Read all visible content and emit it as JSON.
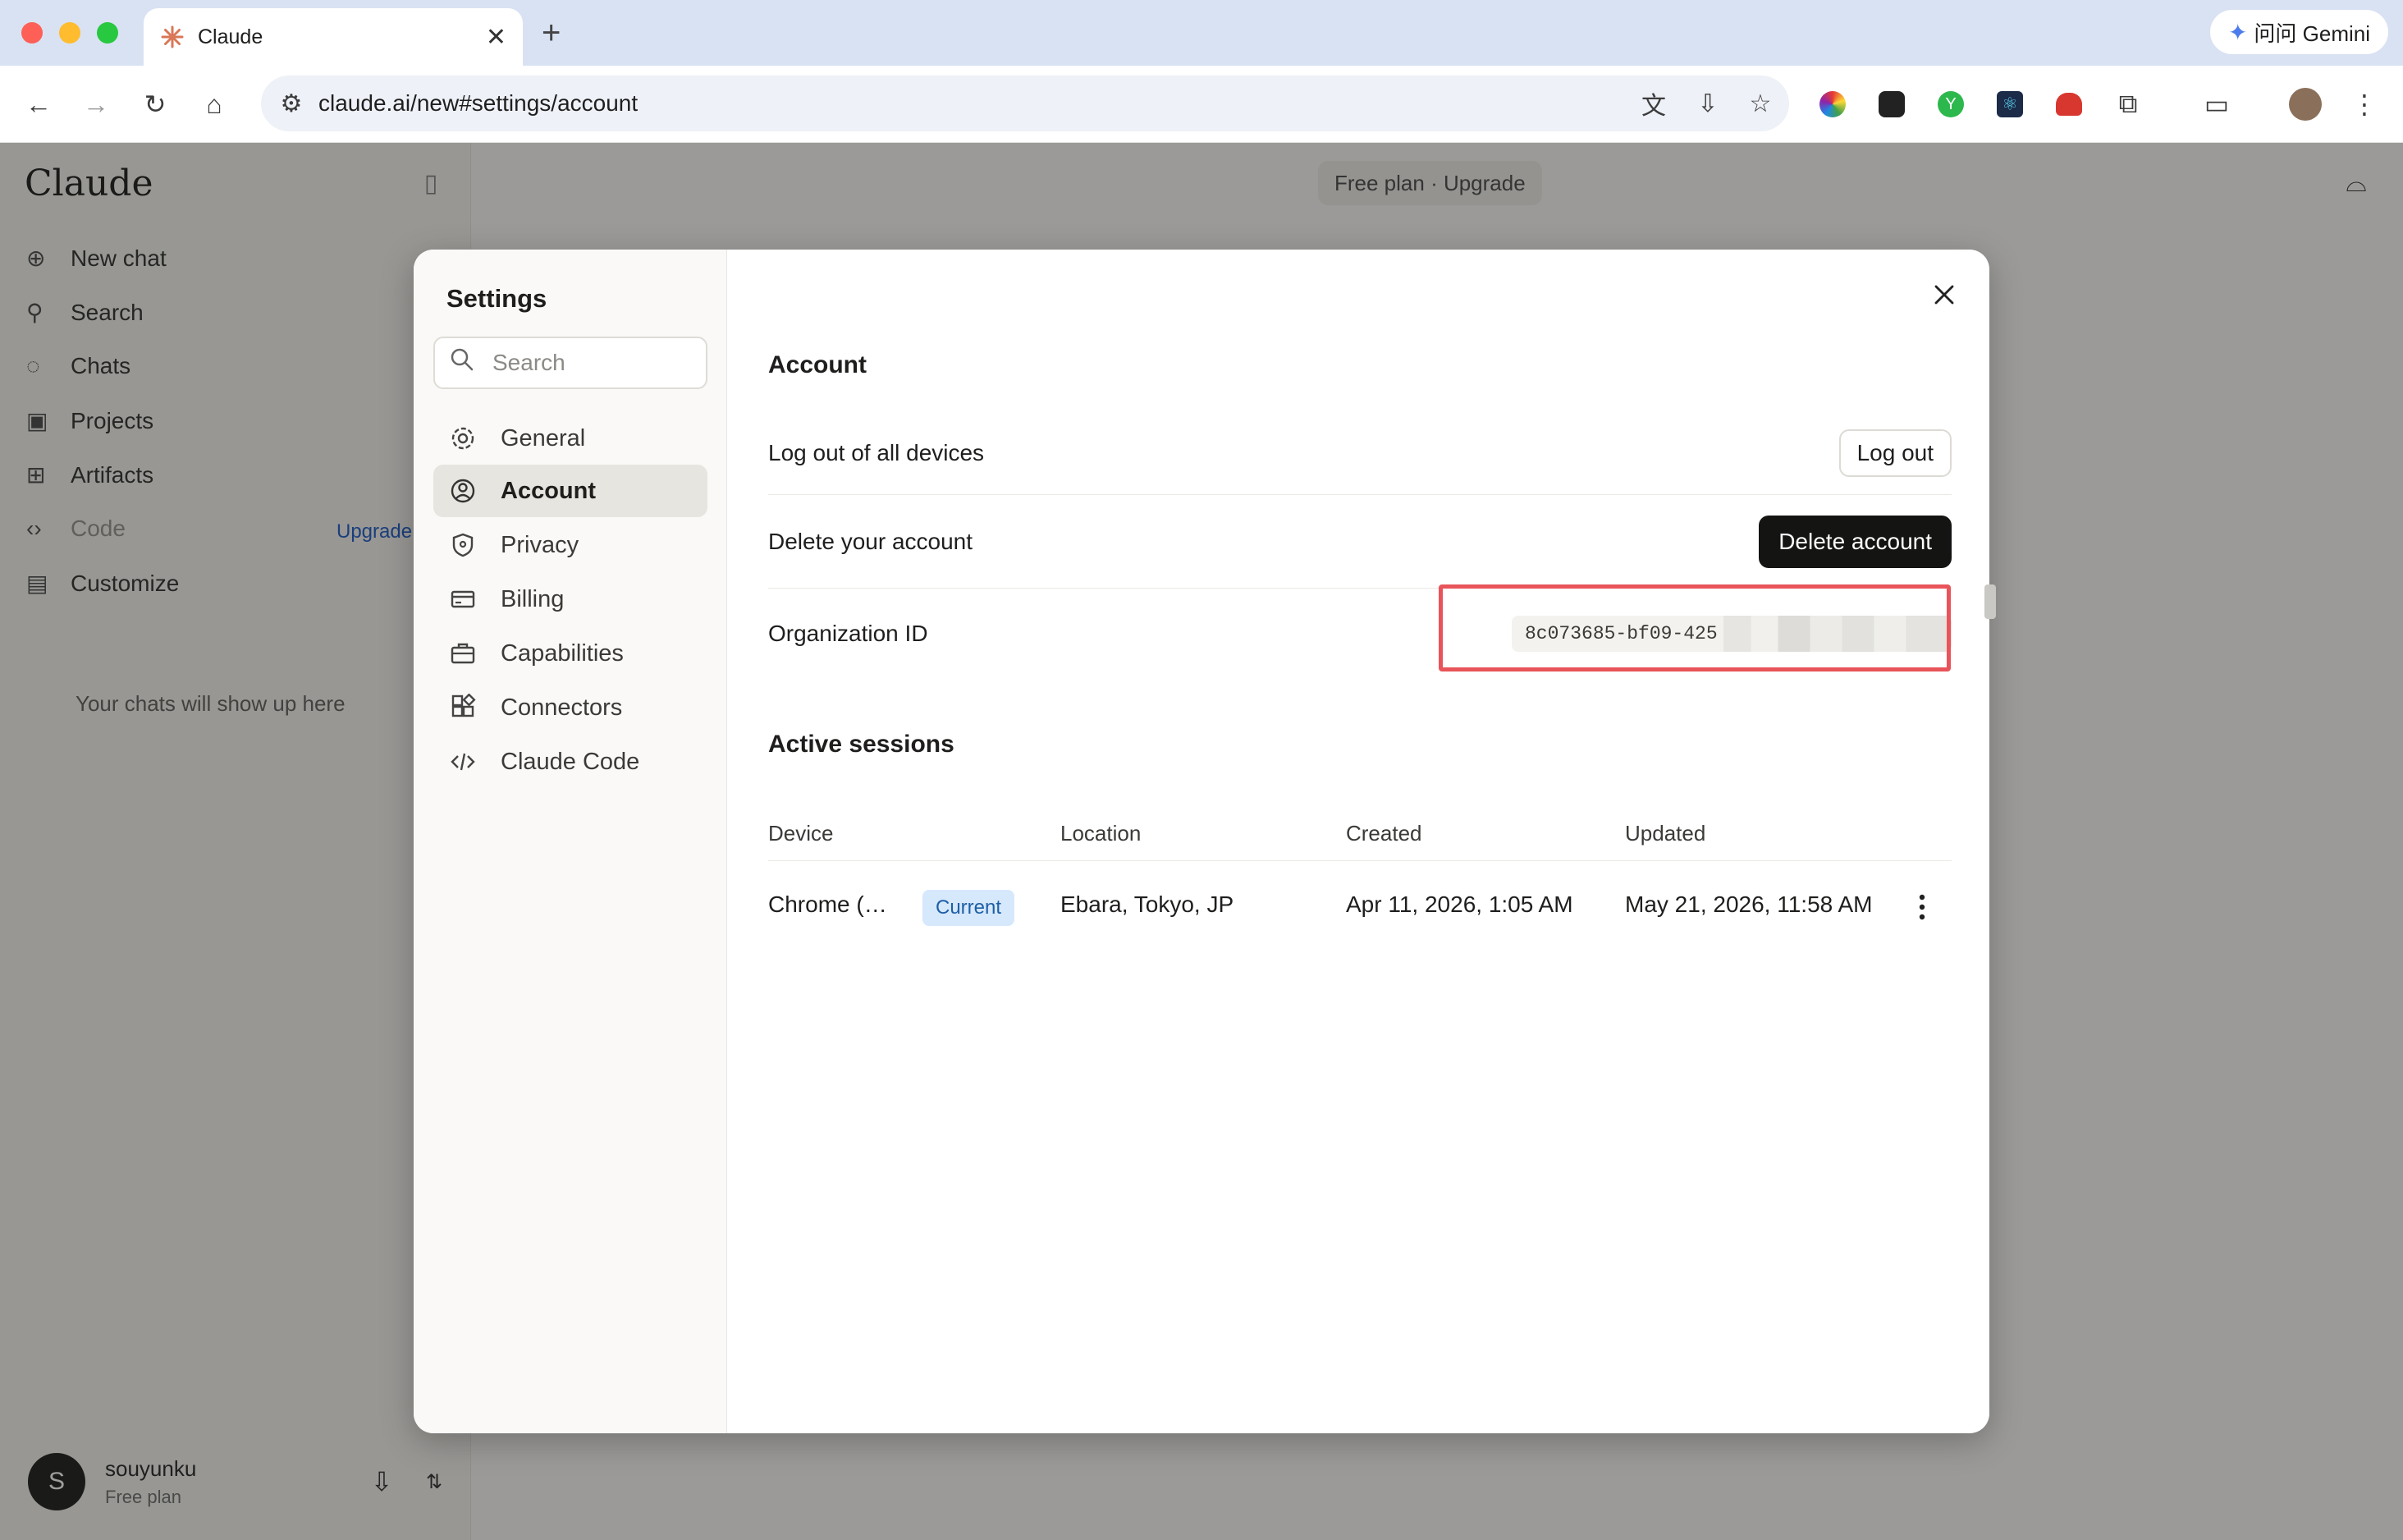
{
  "browser": {
    "tab_title": "Claude",
    "new_tab_symbol": "+",
    "close_symbol": "✕",
    "gemini_label": "问问 Gemini",
    "url": "claude.ai/new#settings/account"
  },
  "app": {
    "logo": "Claude",
    "plan_pill": "Free plan · Upgrade",
    "sidebar": {
      "items": [
        {
          "label": "New chat",
          "icon": "plus-icon"
        },
        {
          "label": "Search",
          "icon": "search-icon"
        },
        {
          "label": "Chats",
          "icon": "chat-icon"
        },
        {
          "label": "Projects",
          "icon": "folder-icon"
        },
        {
          "label": "Artifacts",
          "icon": "artifacts-icon"
        },
        {
          "label": "Code",
          "icon": "code-icon"
        },
        {
          "label": "Customize",
          "icon": "customize-icon"
        }
      ],
      "code_upgrade": "Upgrade",
      "empty_text": "Your chats will show up here"
    },
    "user": {
      "initial": "S",
      "name": "souyunku",
      "plan": "Free plan"
    }
  },
  "settings": {
    "title": "Settings",
    "search_placeholder": "Search",
    "nav": [
      {
        "label": "General",
        "icon": "gear-icon"
      },
      {
        "label": "Account",
        "icon": "account-icon"
      },
      {
        "label": "Privacy",
        "icon": "shield-icon"
      },
      {
        "label": "Billing",
        "icon": "billing-icon"
      },
      {
        "label": "Capabilities",
        "icon": "briefcase-icon"
      },
      {
        "label": "Connectors",
        "icon": "connectors-icon"
      },
      {
        "label": "Claude Code",
        "icon": "code-icon"
      }
    ],
    "active_nav": "Account",
    "account": {
      "title": "Account",
      "logout_label": "Log out of all devices",
      "logout_button": "Log out",
      "delete_label": "Delete your account",
      "delete_button": "Delete account",
      "org_label": "Organization ID",
      "org_id_visible": "8c073685-bf09-425"
    },
    "sessions": {
      "title": "Active sessions",
      "columns": [
        "Device",
        "Location",
        "Created",
        "Updated"
      ],
      "rows": [
        {
          "device": "Chrome (…",
          "badge": "Current",
          "location": "Ebara, Tokyo, JP",
          "created": "Apr 11, 2026, 1:05 AM",
          "updated": "May 21, 2026, 11:58 AM"
        }
      ]
    }
  },
  "colors": {
    "highlight_border": "#e8545a",
    "badge_bg": "#d6e8fb",
    "badge_text": "#1d5fa8",
    "dark_button": "#141413"
  }
}
